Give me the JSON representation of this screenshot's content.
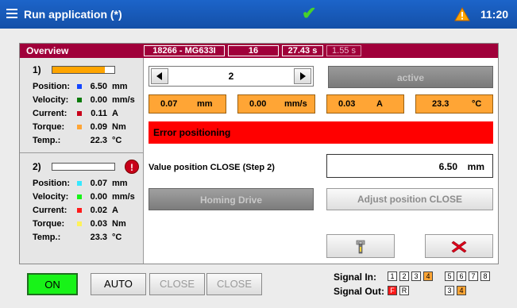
{
  "header": {
    "title": "Run application (*)",
    "time": "11:20"
  },
  "overview": {
    "title": "Overview",
    "info_boxes": [
      "18266 - MG633I",
      "16",
      "27.43 s",
      "1.55 s"
    ]
  },
  "axes": [
    {
      "number": "1)",
      "bar_fill_fraction": 0.85,
      "stats": [
        {
          "label": "Position:",
          "value": "6.50",
          "unit": "mm",
          "color": "#1446ff"
        },
        {
          "label": "Velocity:",
          "value": "0.00",
          "unit": "mm/s",
          "color": "#0a7a0a"
        },
        {
          "label": "Current:",
          "value": "0.11",
          "unit": "A",
          "color": "#c8001a"
        },
        {
          "label": "Torque:",
          "value": "0.09",
          "unit": "Nm",
          "color": "#ffa535"
        },
        {
          "label": "Temp.:",
          "value": "22.3",
          "unit": "°C",
          "color": ""
        }
      ]
    },
    {
      "number": "2)",
      "error_icon": "!",
      "bar_fill_fraction": 0.0,
      "stats": [
        {
          "label": "Position:",
          "value": "0.07",
          "unit": "mm",
          "color": "#36e8ff"
        },
        {
          "label": "Velocity:",
          "value": "0.00",
          "unit": "mm/s",
          "color": "#18f318"
        },
        {
          "label": "Current:",
          "value": "0.02",
          "unit": "A",
          "color": "#ff1a1a"
        },
        {
          "label": "Torque:",
          "value": "0.03",
          "unit": "Nm",
          "color": "#fff25a"
        },
        {
          "label": "Temp.:",
          "value": "23.3",
          "unit": "°C",
          "color": ""
        }
      ]
    }
  ],
  "main": {
    "step": "2",
    "active_label": "active",
    "readouts": [
      {
        "value": "0.07",
        "unit": "mm"
      },
      {
        "value": "0.00",
        "unit": "mm/s"
      },
      {
        "value": "0.03",
        "unit": "A"
      },
      {
        "value": "23.3",
        "unit": "°C"
      }
    ],
    "error_text": "Error positioning",
    "value_label": "Value position CLOSE (Step 2)",
    "value": "6.50",
    "value_unit": "mm",
    "homing_label": "Homing Drive",
    "adjust_label": "Adjust position CLOSE"
  },
  "bottom": {
    "buttons": [
      "ON",
      "AUTO",
      "CLOSE",
      "CLOSE"
    ],
    "signal_in_label": "Signal In:",
    "signal_out_label": "Signal Out:",
    "signal_in": [
      "1",
      "2",
      "3",
      "4",
      "5",
      "6",
      "7",
      "8"
    ],
    "signal_out_a": [
      "F",
      "R"
    ],
    "signal_out_b": [
      "3",
      "4"
    ]
  },
  "colors": {
    "accent": "#a0003a",
    "orange": "#ffa535",
    "error": "#ff0000",
    "on": "#18f318"
  }
}
